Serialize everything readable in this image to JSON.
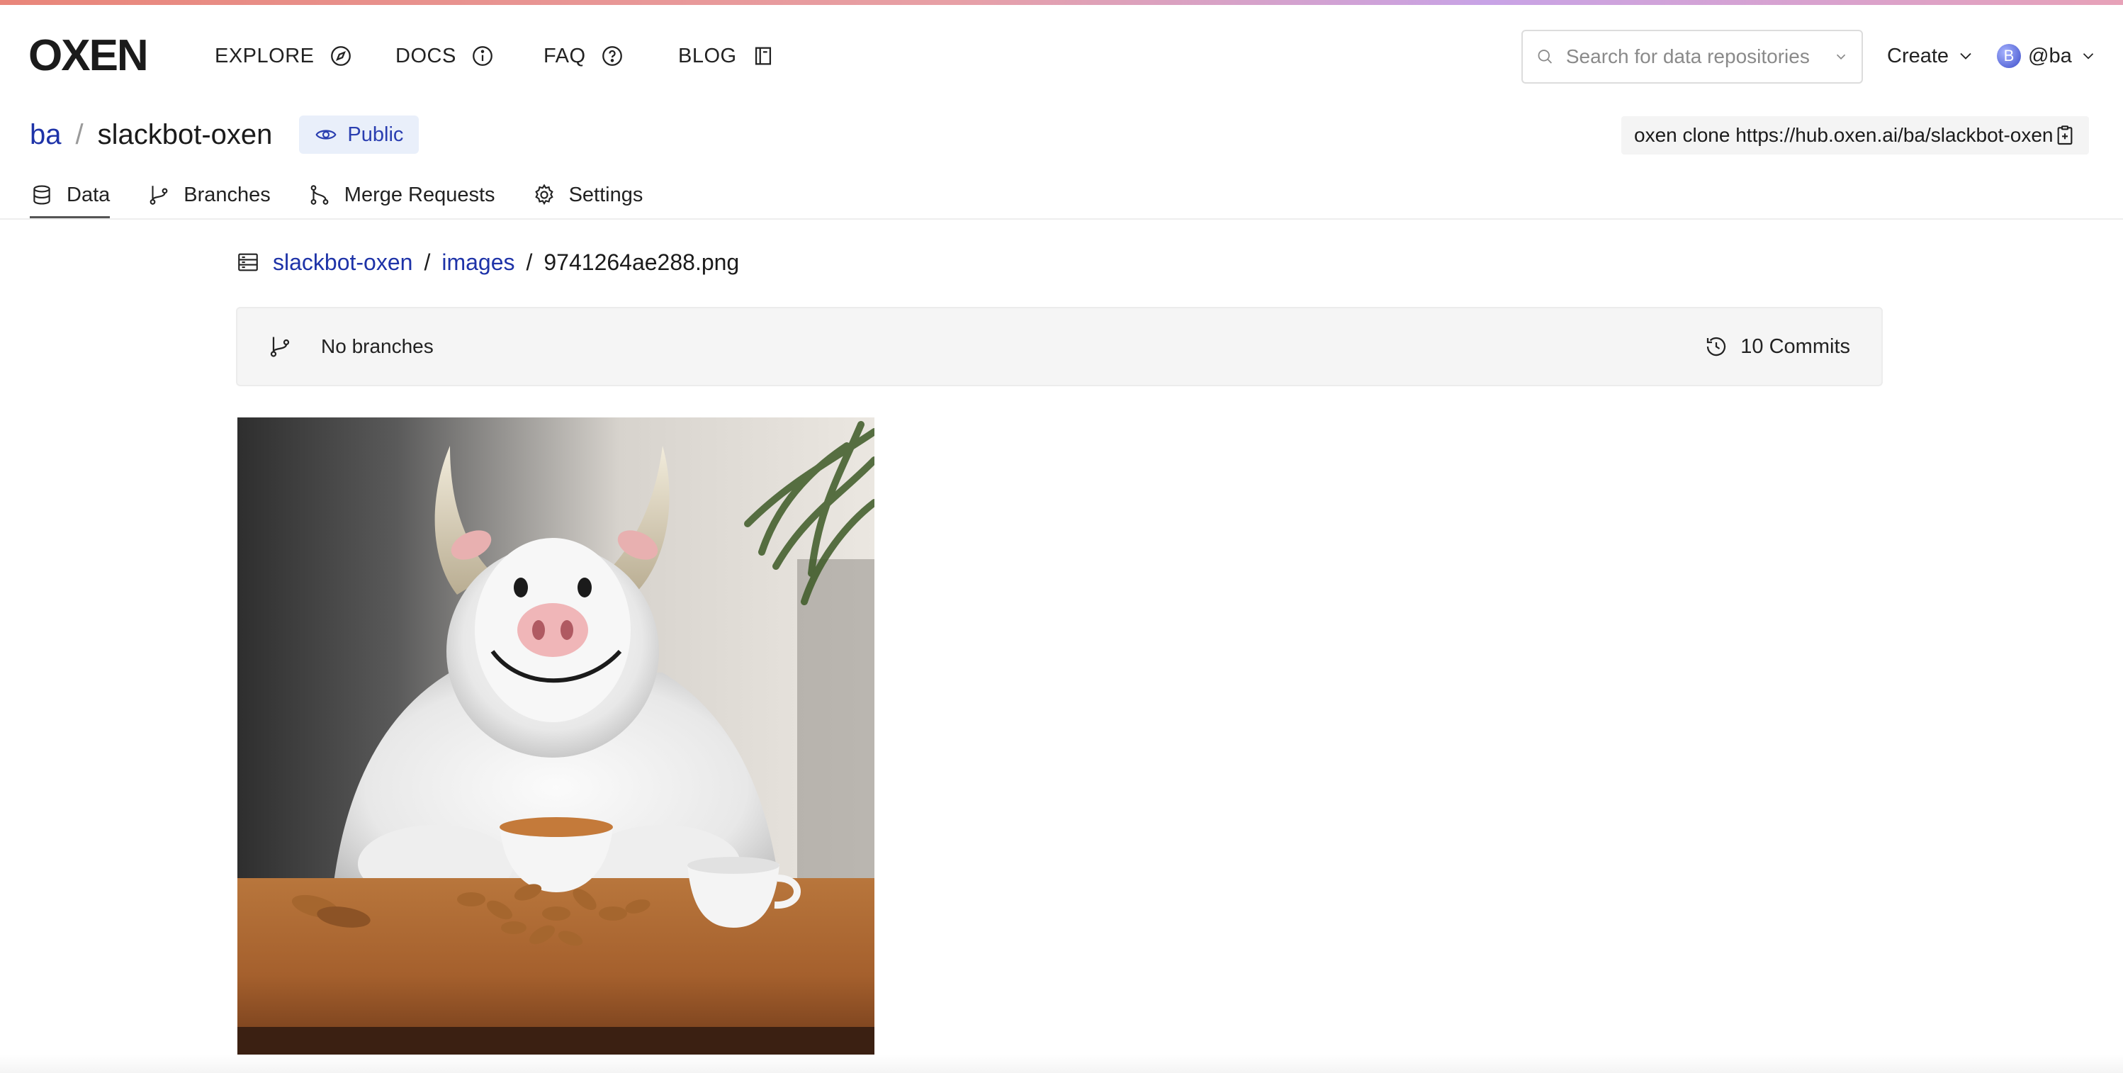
{
  "header": {
    "logo_text": "OXEN",
    "nav": [
      {
        "label": "EXPLORE",
        "icon": "compass-icon"
      },
      {
        "label": "DOCS",
        "icon": "info-icon"
      },
      {
        "label": "FAQ",
        "icon": "question-icon"
      },
      {
        "label": "BLOG",
        "icon": "book-icon"
      }
    ],
    "search_placeholder": "Search for data repositories",
    "create_label": "Create",
    "user_initial": "B",
    "user_label": "@ba"
  },
  "repo": {
    "owner": "ba",
    "separator": "/",
    "name": "slackbot-oxen",
    "visibility": "Public",
    "clone_command": "oxen clone https://hub.oxen.ai/ba/slackbot-oxen"
  },
  "tabs": [
    {
      "label": "Data",
      "icon": "database-icon",
      "active": true
    },
    {
      "label": "Branches",
      "icon": "branch-icon",
      "active": false
    },
    {
      "label": "Merge Requests",
      "icon": "merge-icon",
      "active": false
    },
    {
      "label": "Settings",
      "icon": "gear-icon",
      "active": false
    }
  ],
  "breadcrumb": {
    "root": "slackbot-oxen",
    "folder": "images",
    "file": "9741264ae288.png",
    "sep": "/"
  },
  "branch_bar": {
    "branches_text": "No branches",
    "commits_text": "10 Commits"
  },
  "colors": {
    "link": "#1e33a8",
    "badge_bg": "#e9effa",
    "panel_bg": "#f5f5f5"
  }
}
